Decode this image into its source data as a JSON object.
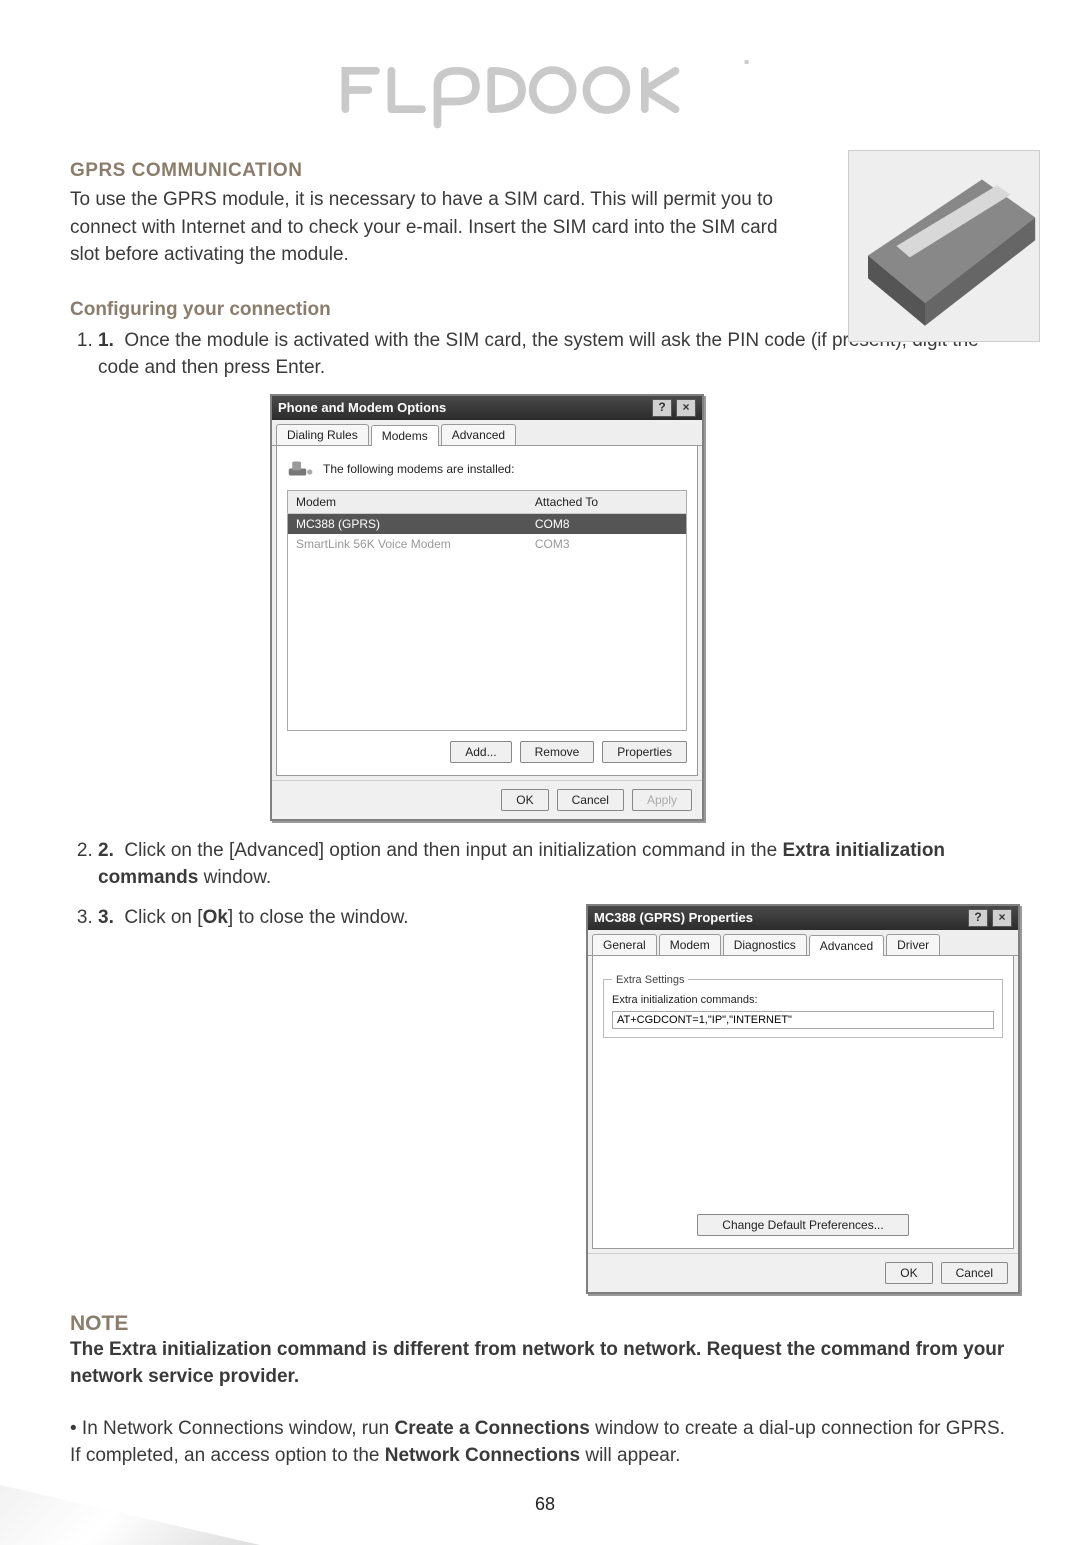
{
  "page_number": "68",
  "section": {
    "title": "GPRS COMMUNICATION",
    "intro": "To use the GPRS module, it is necessary to have a SIM card. This will permit you to connect with Internet and to check your e-mail. Insert the SIM card into the SIM card slot before activating the module.",
    "subhead": "Configuring your connection"
  },
  "steps": {
    "s1": "Once the module is activated with the SIM card, the system will ask the PIN code (if present), digit the code and then press Enter.",
    "s2_pre": "Click on the [Advanced] option and then input an initialization command in the ",
    "s2_bold": "Extra initialization commands",
    "s2_post": " window.",
    "s3_pre": "Click on [",
    "s3_bold": "Ok",
    "s3_post": "] to close the window."
  },
  "dialog1": {
    "title": "Phone and Modem Options",
    "tabs": {
      "t1": "Dialing Rules",
      "t2": "Modems",
      "t3": "Advanced"
    },
    "info": "The following modems are installed:",
    "col_modem": "Modem",
    "col_attached": "Attached To",
    "rows": [
      {
        "name": "MC388 (GPRS)",
        "port": "COM8"
      },
      {
        "name": "SmartLink 56K Voice Modem",
        "port": "COM3"
      }
    ],
    "buttons": {
      "add": "Add...",
      "remove": "Remove",
      "props": "Properties"
    },
    "footer": {
      "ok": "OK",
      "cancel": "Cancel",
      "apply": "Apply"
    }
  },
  "dialog2": {
    "title": "MC388 (GPRS) Properties",
    "tabs": {
      "t1": "General",
      "t2": "Modem",
      "t3": "Diagnostics",
      "t4": "Advanced",
      "t5": "Driver"
    },
    "legend": "Extra Settings",
    "label": "Extra initialization commands:",
    "value": "AT+CGDCONT=1,\"IP\",\"INTERNET\"",
    "change_btn": "Change Default Preferences...",
    "footer": {
      "ok": "OK",
      "cancel": "Cancel"
    }
  },
  "note": {
    "label": "NOTE",
    "bold": "The Extra initialization command is different from network to network. Request the command from your network service provider.",
    "bullet_pre": "• In Network Connections window, run ",
    "bullet_b1": "Create a Connections",
    "bullet_mid": " window to create a dial-up connection for GPRS. If completed, an access option to the ",
    "bullet_b2": "Network Connections",
    "bullet_post": " will appear."
  }
}
